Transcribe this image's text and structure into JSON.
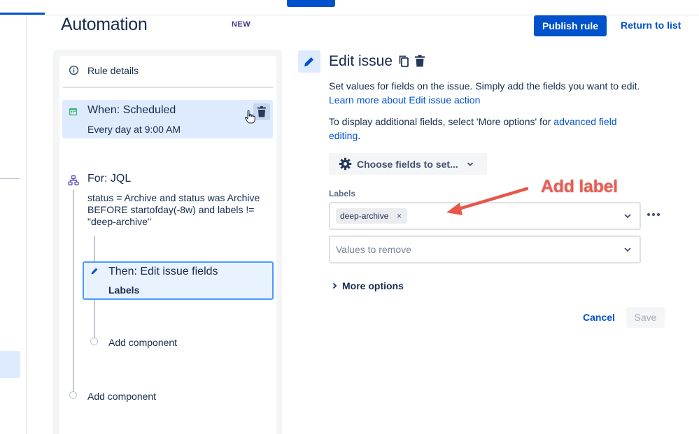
{
  "header": {
    "title": "Automation",
    "badge": "NEW",
    "publish_label": "Publish rule",
    "return_label": "Return to list"
  },
  "rule_flow": {
    "details_label": "Rule details",
    "trigger": {
      "title": "When: Scheduled",
      "subtitle": "Every day at 9:00 AM"
    },
    "branch": {
      "title": "For: JQL",
      "jql": "status = Archive and status was Archive BEFORE startofday(-8w) and labels != \"deep-archive\""
    },
    "action": {
      "title": "Then: Edit issue fields",
      "subtitle": "Labels"
    },
    "inner_add_label": "Add component",
    "outer_add_label": "Add component"
  },
  "config": {
    "heading": "Edit issue",
    "desc_text": "Set values for fields on the issue. Simply add the fields you want to edit.",
    "desc_link": "Learn more about Edit issue action",
    "desc2_text": "To display additional fields, select 'More options' for",
    "desc2_link": "advanced field editing",
    "desc2_end": ".",
    "choose_fields_label": "Choose fields to set...",
    "labels_field_label": "Labels",
    "label_tags": [
      "deep-archive"
    ],
    "tag_remove": "×",
    "remove_placeholder": "Values to remove",
    "more_options_label": "More options",
    "cancel_label": "Cancel",
    "save_label": "Save"
  },
  "annotation": {
    "text": "Add label",
    "color": "#ee5a4f"
  },
  "colors": {
    "primary": "#0052cc",
    "selected_bg": "#deebff",
    "text": "#172b4d"
  }
}
